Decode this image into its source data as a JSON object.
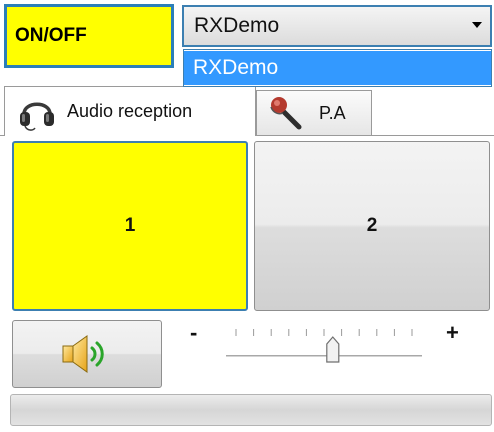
{
  "power": {
    "label": "ON/OFF"
  },
  "receiver": {
    "selected": "RXDemo",
    "options": [
      "RXDemo"
    ]
  },
  "tabs": [
    {
      "label": "Audio reception",
      "icon": "headphones-icon",
      "selected": true
    },
    {
      "label": "P.A",
      "icon": "microphone-icon",
      "selected": false
    }
  ],
  "channels": [
    {
      "label": "1",
      "active": true
    },
    {
      "label": "2",
      "active": false
    }
  ],
  "volume": {
    "minus_label": "-",
    "plus_label": "+",
    "level": 0.55,
    "ticks": 11
  },
  "speaker": {
    "icon": "speaker-icon"
  },
  "progress": {
    "value": 0
  },
  "colors": {
    "active": "#ffff00",
    "accent": "#3c7fb1",
    "selection": "#3399ff"
  }
}
